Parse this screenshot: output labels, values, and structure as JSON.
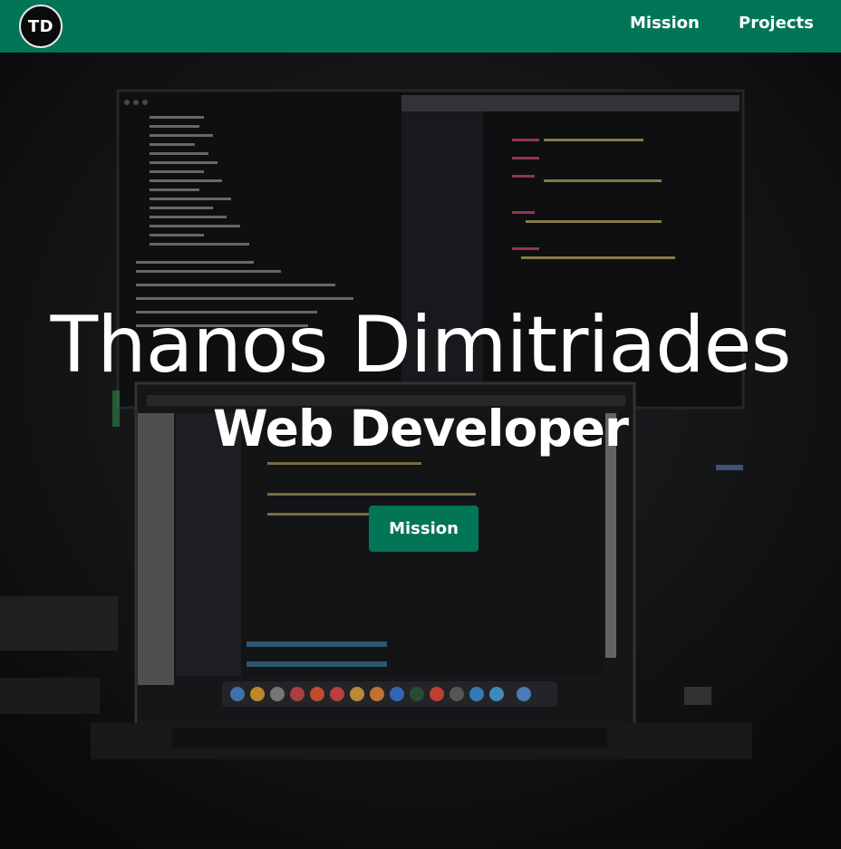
{
  "nav": {
    "logo_text": "TD",
    "links": [
      {
        "label": "Mission"
      },
      {
        "label": "Projects"
      }
    ]
  },
  "hero": {
    "title": "Thanos Dimitriades",
    "subtitle": "Web Developer",
    "cta_label": "Mission"
  },
  "colors": {
    "primary": "#037557",
    "background": "#0d0e0f"
  }
}
